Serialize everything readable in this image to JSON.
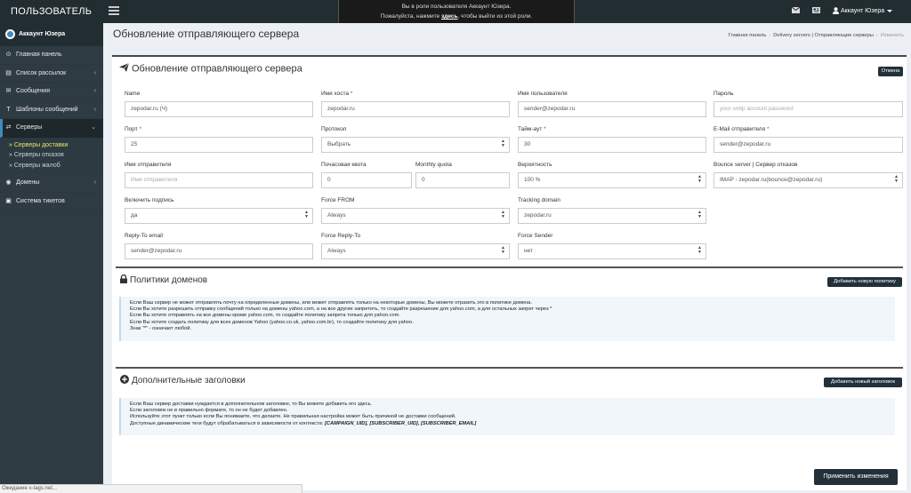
{
  "header": {
    "app_title": "ПОЛЬЗОВАТЕЛЬ",
    "impersonate_line1": "Вы в роли пользователя Аккаунт Юзера.",
    "impersonate_line2_pre": "Пожалуйста, нажмите ",
    "impersonate_link": "здесь",
    "impersonate_line2_post": ", чтобы выйти из этой роли.",
    "user_name": "Аккаунт Юзера"
  },
  "sidebar": {
    "account_name": "Аккаунт Юзера",
    "items": [
      {
        "label": "Главная панель",
        "icon": "dashboard-icon"
      },
      {
        "label": "Список рассылок",
        "icon": "list-icon"
      },
      {
        "label": "Сообщения",
        "icon": "envelope-icon"
      },
      {
        "label": "Шаблоны сообщений",
        "icon": "text-icon"
      },
      {
        "label": "Серверы",
        "icon": "exchange-icon"
      },
      {
        "label": "Домены",
        "icon": "globe-icon"
      },
      {
        "label": "Система тикетов",
        "icon": "ticket-icon"
      }
    ],
    "servers_sub": [
      "Серверы доставки",
      "Серверы отказов",
      "Серверы жалоб"
    ]
  },
  "page": {
    "title": "Обновление отправляющего сервера",
    "breadcrumb": [
      "Главная панель",
      "Delivery servers | Отправляющие серверы",
      "Изменить"
    ]
  },
  "form": {
    "box_title": "Обновление отправляющего сервера",
    "cancel_label": "Отмена",
    "fields": {
      "name": {
        "label": "Name",
        "value": "zepodar.ru (Ч)"
      },
      "hostname": {
        "label": "Имя хоста",
        "value": "zepodar.ru"
      },
      "username": {
        "label": "Имя пользователя",
        "value": "sender@zepodar.ru"
      },
      "password": {
        "label": "Пароль",
        "placeholder": "your smtp account password"
      },
      "port": {
        "label": "Порт",
        "value": "25"
      },
      "protocol": {
        "label": "Протокол",
        "value": "Выбрать"
      },
      "timeout": {
        "label": "Тайм-аут",
        "value": "30"
      },
      "from_email": {
        "label": "E-Mail отправителя",
        "value": "sender@zepodar.ru"
      },
      "from_name": {
        "label": "Имя отправителя",
        "placeholder": "Имя отправителя"
      },
      "hourly_quota": {
        "label": "Почасовая квота",
        "value": "0"
      },
      "monthly_quota": {
        "label": "Monthly quota",
        "value": "0"
      },
      "probability": {
        "label": "Вероятность",
        "value": "100 %"
      },
      "bounce_server": {
        "label": "Bounce server | Сервер отказов",
        "value": "IMAP - zepodar.ru(bounce@zepodar.ru)"
      },
      "signing": {
        "label": "Включить подпись",
        "value": "да"
      },
      "force_from": {
        "label": "Force FROM",
        "value": "Always"
      },
      "tracking_domain": {
        "label": "Tracking domain",
        "value": "zepodar.ru"
      },
      "reply_to": {
        "label": "Reply-To email",
        "value": "sender@zepodar.ru"
      },
      "force_reply_to": {
        "label": "Force Reply-To",
        "value": "Always"
      },
      "force_sender": {
        "label": "Force Sender",
        "value": "нет"
      }
    }
  },
  "domain_policies": {
    "title": "Политики доменов",
    "add_label": "Добавить новую политику",
    "info_lines": [
      "Если Ваш сервер не может отправлять почту на определенные домены, или может отправлять только на некоторые домены, Вы можете отразить это в политике домена.",
      "Если Вы хотите разрешить отправку сообщений только на домены yahoo.com, а на все другие запретить, то создайте разрешение для yahoo.com, а для остальных запрет через *",
      "Если Вы хотите отправлять на все домены кроме yahoo.com, то создайте политику запрета только для yahoo.com.",
      "Если Вы хотите создать политику для всех доменов Yahoo (yahoo.co.uk, yahoo.com.br), то создайте политику для yahoo.",
      "Знак \"*\" - означает любой."
    ]
  },
  "extra_headers": {
    "title": "Дополнительные заголовки",
    "add_label": "Добавить новый заголовок",
    "info_lines": [
      "Если Ваш сервер доставки нуждается в дополнительном заголовке, то Вы можете добавить его здесь.",
      "Если заголовок не в правильно формате, то он не будет добавлен.",
      "Используйте этот пункт только если Вы понимаете, что делаете. Не правильная настройка может быть причиной не доставки сообщений.",
      "Доступные динамические теги будут обрабатываться в зависимости от контекста: "
    ],
    "tags": "[CAMPAIGN_UID], [SUBSCRIBER_UID], [SUBSCRIBER_EMAIL]"
  },
  "apply_label": "Применить изменения",
  "status_text": "Ожидание x-tags.net..."
}
